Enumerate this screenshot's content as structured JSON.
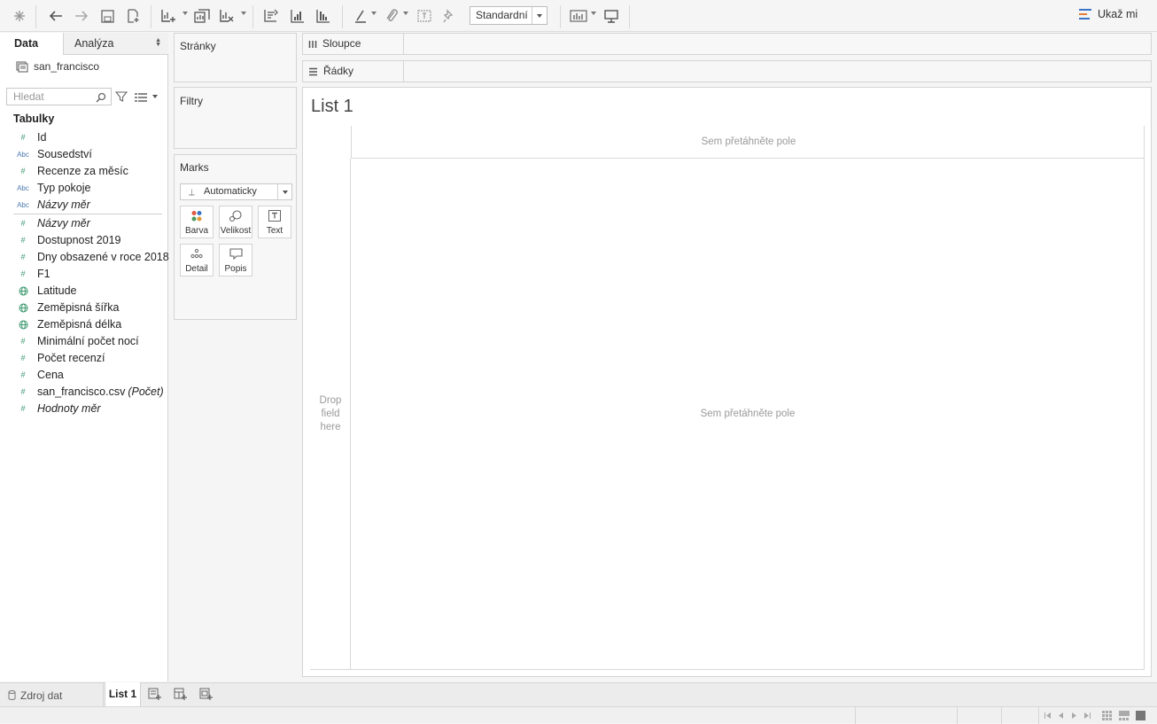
{
  "toolbar": {
    "fit_value": "Standardní",
    "show_me_label": "Ukaž mi"
  },
  "data_pane": {
    "tabs": {
      "data": "Data",
      "analysis": "Analýza"
    },
    "datasource_name": "san_francisco",
    "search_placeholder": "Hledat",
    "tables_heading": "Tabulky",
    "dimensions": [
      {
        "name": "Id",
        "type": "number"
      },
      {
        "name": "Sousedství",
        "type": "string"
      },
      {
        "name": "Recenze za měsíc",
        "type": "number"
      },
      {
        "name": "Typ pokoje",
        "type": "string"
      },
      {
        "name": "Názvy měr",
        "type": "string",
        "italic": true
      }
    ],
    "measures": [
      {
        "name": "Názvy měr",
        "type": "number",
        "italic": true
      },
      {
        "name": "Dostupnost 2019",
        "type": "number"
      },
      {
        "name": "Dny obsazené v roce 2018",
        "type": "number"
      },
      {
        "name": "F1",
        "type": "number"
      },
      {
        "name": "Latitude",
        "type": "geo"
      },
      {
        "name": "Zeměpisná šířka",
        "type": "geo"
      },
      {
        "name": "Zeměpisná délka",
        "type": "geo"
      },
      {
        "name": "Minimální počet nocí",
        "type": "number"
      },
      {
        "name": "Počet recenzí",
        "type": "number"
      },
      {
        "name": "Cena",
        "type": "number"
      },
      {
        "name": "san_francisco.csv",
        "suffix": "(Počet)",
        "type": "number"
      },
      {
        "name": "Hodnoty měr",
        "type": "number",
        "italic": true
      }
    ]
  },
  "cards": {
    "pages": "Stránky",
    "filters": "Filtry",
    "marks": "Marks",
    "marks_type": "Automaticky",
    "mark_buttons": {
      "color": "Barva",
      "size": "Velikost",
      "text": "Text",
      "detail": "Detail",
      "tooltip": "Popis"
    }
  },
  "shelves": {
    "columns": "Sloupce",
    "rows": "Řádky"
  },
  "canvas": {
    "sheet_title": "List 1",
    "col_hint": "Sem přetáhněte pole",
    "body_hint": "Sem přetáhněte pole",
    "row_hint_1": "Drop",
    "row_hint_2": "field",
    "row_hint_3": "here"
  },
  "sheet_bar": {
    "datasource_tab": "Zdroj dat",
    "sheet_tab": "List 1"
  },
  "colors": {
    "accent_number": "#3d9970",
    "accent_string": "#4a7ab0"
  }
}
